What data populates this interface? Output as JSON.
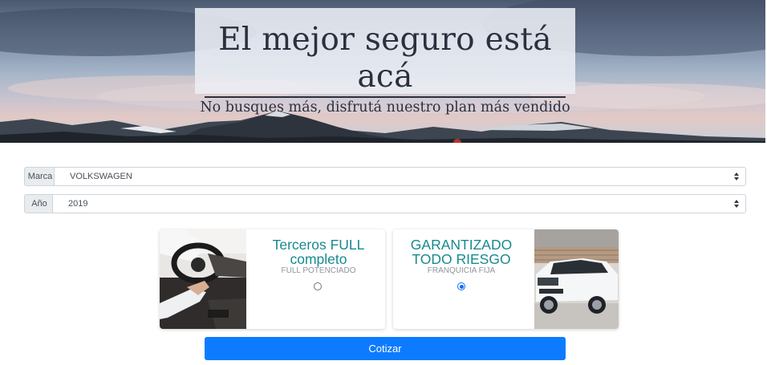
{
  "hero": {
    "title": "El mejor seguro está acá",
    "subtitle": "No busques más, disfrutá nuestro plan más vendido"
  },
  "form": {
    "marca": {
      "label": "Marca",
      "value": "VOLKSWAGEN"
    },
    "ano": {
      "label": "Año",
      "value": "2019"
    }
  },
  "plans": [
    {
      "title_line1": "Terceros FULL",
      "title_line2": "completo",
      "subtitle": "FULL POTENCIADO",
      "selected": false
    },
    {
      "title_line1": "GARANTIZADO",
      "title_line2": "TODO RIESGO",
      "subtitle": "FRANQUICIA FIJA",
      "selected": true
    }
  ],
  "submit": {
    "label": "Cotizar"
  },
  "colors": {
    "accent": "#0d7bff",
    "plan_title": "#178a8f"
  }
}
